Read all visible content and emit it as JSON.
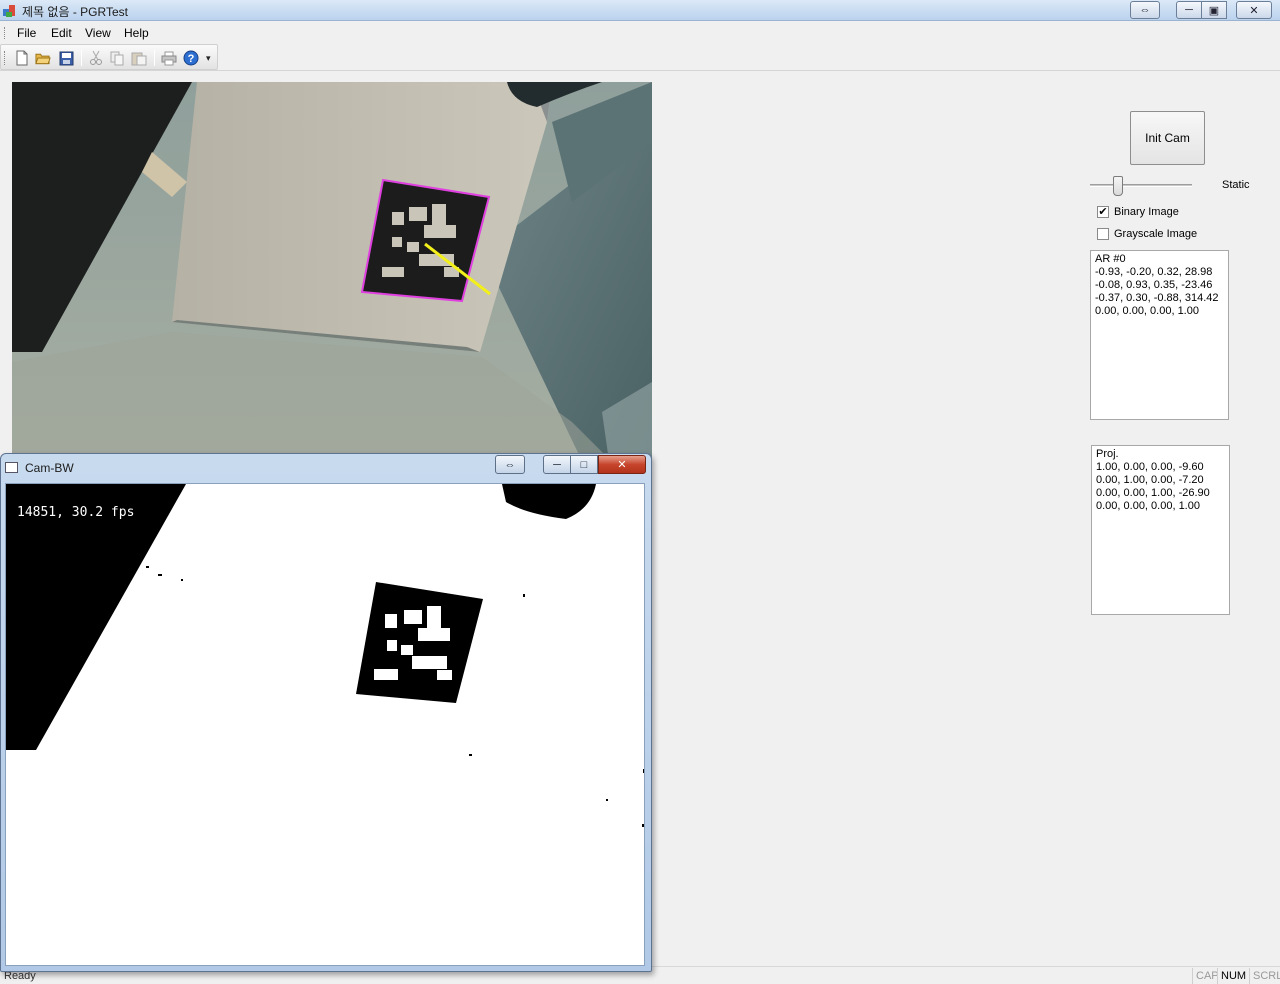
{
  "window": {
    "title": "제목 없음 - PGRTest",
    "buttons": {
      "extra": "⇔",
      "minimize": "─",
      "maximize": "▣",
      "close": "✕"
    }
  },
  "menu": {
    "items": [
      "File",
      "Edit",
      "View",
      "Help"
    ]
  },
  "toolbar": {
    "icons": [
      "new-file-icon",
      "open-folder-icon",
      "save-icon",
      "cut-icon",
      "copy-icon",
      "paste-icon",
      "print-icon",
      "help-icon"
    ]
  },
  "panel": {
    "init_button": "Init Cam",
    "slider_label": "Static",
    "slider_value": 0.25,
    "binary_checkbox": {
      "label": "Binary Image",
      "checked": true,
      "mark": "✔"
    },
    "grayscale_checkbox": {
      "label": "Grayscale Image",
      "checked": false,
      "mark": ""
    },
    "ar_text": "AR #0\n-0.93, -0.20, 0.32, 28.98\n-0.08, 0.93, 0.35, -23.46\n-0.37, 0.30, -0.88, 314.42\n0.00, 0.00, 0.00, 1.00",
    "proj_text": "Proj.\n1.00, 0.00, 0.00, -9.60\n0.00, 1.00, 0.00, -7.20\n0.00, 0.00, 1.00, -26.90\n0.00, 0.00, 0.00, 1.00"
  },
  "child_window": {
    "title": "Cam-BW",
    "fps_overlay": "14851, 30.2 fps",
    "buttons": {
      "extra": "⇔",
      "minimize": "─",
      "maximize": "□",
      "close": "✕"
    }
  },
  "statusbar": {
    "text": "Ready",
    "indicators": [
      {
        "label": "CAP",
        "active": false
      },
      {
        "label": "NUM",
        "active": true
      },
      {
        "label": "SCRL",
        "active": false
      }
    ]
  },
  "colors": {
    "marker_outline": "#e040e0",
    "axis_line": "#f2ef1a",
    "title_gradient": "#c7dbf1"
  }
}
